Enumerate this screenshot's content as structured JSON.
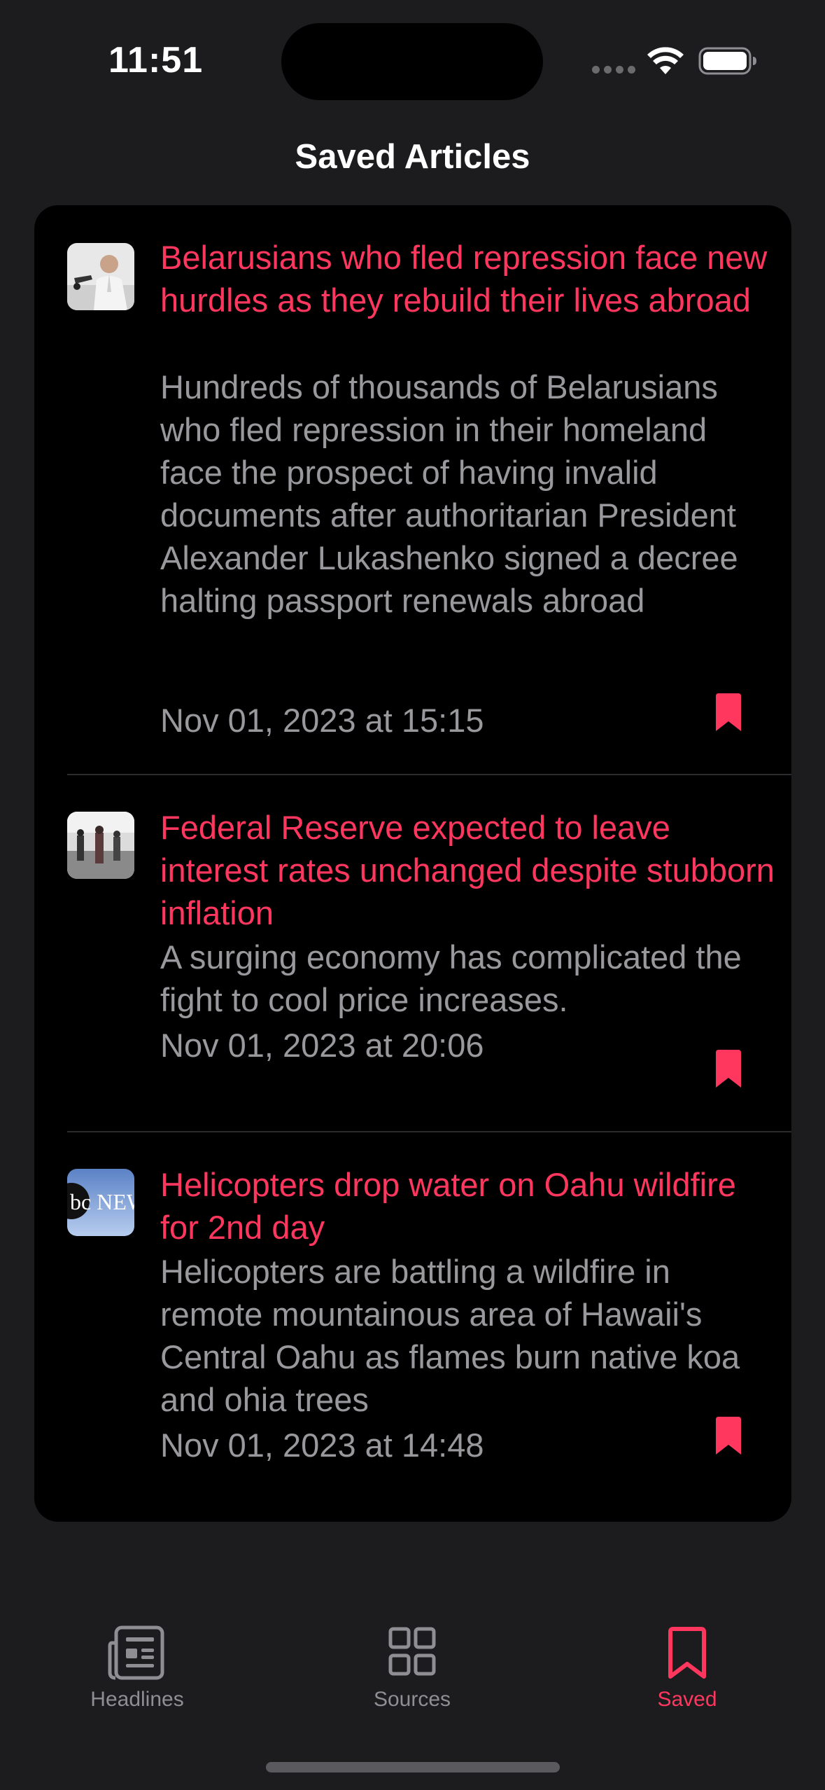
{
  "status_bar": {
    "time": "11:51"
  },
  "nav": {
    "title": "Saved Articles"
  },
  "colors": {
    "accent": "#ff375f",
    "background": "#1c1c1e",
    "card": "#000000",
    "secondary_text": "#98989d",
    "tab_inactive": "#8e8e93"
  },
  "articles": [
    {
      "headline": "Belarusians who fled repression face new hurdles as they rebuild their lives abroad",
      "summary": "Hundreds of thousands of Belarusians who fled repression in their homeland face the prospect of having invalid documents after authoritarian President Alexander Lukashenko signed a decree halting passport renewals abroad",
      "date": "Nov 01, 2023 at 15:15",
      "icon": "bookmark-filled-icon"
    },
    {
      "headline": "Federal Reserve expected to leave interest rates unchanged despite stubborn inflation",
      "summary": "A surging economy has complicated the fight to cool price increases.",
      "date": "Nov 01, 2023 at 20:06",
      "icon": "bookmark-filled-icon"
    },
    {
      "headline": "Helicopters drop water on Oahu wildfire for 2nd day",
      "summary": "Helicopters are battling a wildfire in remote mountainous area of Hawaii's Central Oahu as flames burn native koa and ohia trees",
      "date": "Nov 01, 2023 at 14:48",
      "thumb_text": "bc NEW",
      "icon": "bookmark-filled-icon"
    }
  ],
  "tabs": [
    {
      "label": "Headlines",
      "icon": "newspaper-icon",
      "selected": false
    },
    {
      "label": "Sources",
      "icon": "grid-icon",
      "selected": false
    },
    {
      "label": "Saved",
      "icon": "bookmark-icon",
      "selected": true
    }
  ]
}
